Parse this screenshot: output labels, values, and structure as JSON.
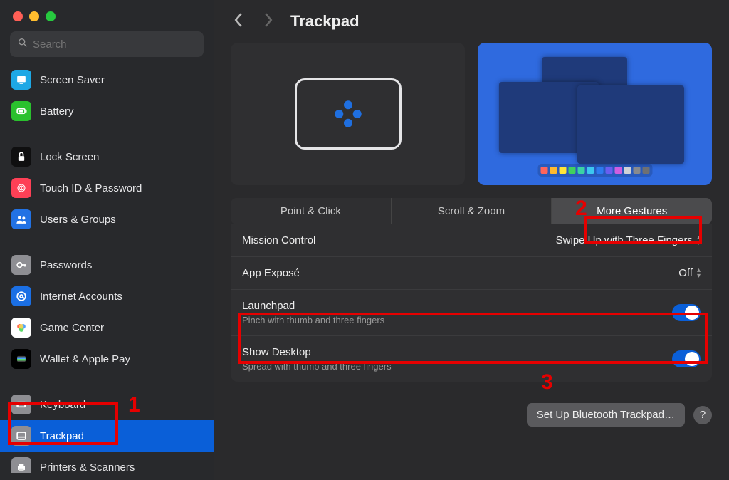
{
  "header": {
    "title": "Trackpad"
  },
  "search": {
    "placeholder": "Search"
  },
  "sidebar": {
    "items": [
      {
        "label": "Screen Saver",
        "iconBg": "#1ea8e5",
        "icon": "screensaver"
      },
      {
        "label": "Battery",
        "iconBg": "#2ac12e",
        "icon": "battery"
      },
      {
        "gap": true
      },
      {
        "label": "Lock Screen",
        "iconBg": "#0f0f10",
        "icon": "lock"
      },
      {
        "label": "Touch ID & Password",
        "iconBg": "#fe4056",
        "icon": "fingerprint"
      },
      {
        "label": "Users & Groups",
        "iconBg": "#2272e4",
        "icon": "users"
      },
      {
        "gap": true
      },
      {
        "label": "Passwords",
        "iconBg": "#8e8e93",
        "icon": "key"
      },
      {
        "label": "Internet Accounts",
        "iconBg": "#1b6fe4",
        "icon": "at"
      },
      {
        "label": "Game Center",
        "iconBg": "#ffffff",
        "icon": "gamecenter"
      },
      {
        "label": "Wallet & Apple Pay",
        "iconBg": "#000000",
        "icon": "wallet"
      },
      {
        "gap": true
      },
      {
        "label": "Keyboard",
        "iconBg": "#8e8e93",
        "icon": "keyboard"
      },
      {
        "label": "Trackpad",
        "iconBg": "#8e8e93",
        "icon": "trackpad",
        "selected": true
      },
      {
        "label": "Printers & Scanners",
        "iconBg": "#8e8e93",
        "icon": "printer"
      }
    ]
  },
  "tabs": [
    {
      "label": "Point & Click",
      "active": false
    },
    {
      "label": "Scroll & Zoom",
      "active": false
    },
    {
      "label": "More Gestures",
      "active": true
    }
  ],
  "settings": {
    "missionControl": {
      "title": "Mission Control",
      "value": "Swipe Up with Three Fingers"
    },
    "appExpose": {
      "title": "App Exposé",
      "value": "Off"
    },
    "launchpad": {
      "title": "Launchpad",
      "sub": "Pinch with thumb and three fingers",
      "on": true
    },
    "showDesktop": {
      "title": "Show Desktop",
      "sub": "Spread with thumb and three fingers",
      "on": true
    }
  },
  "footer": {
    "button": "Set Up Bluetooth Trackpad…",
    "help": "?"
  },
  "annotations": {
    "n1": "1",
    "n2": "2",
    "n3": "3"
  },
  "dockColors": [
    "#ff655c",
    "#ffb92e",
    "#ffe638",
    "#40d15e",
    "#3bd3a4",
    "#3dc7ef",
    "#2d7bf0",
    "#6a5ef0",
    "#cf5ee0",
    "#d0d2d6",
    "#888a8d",
    "#6e7073"
  ]
}
